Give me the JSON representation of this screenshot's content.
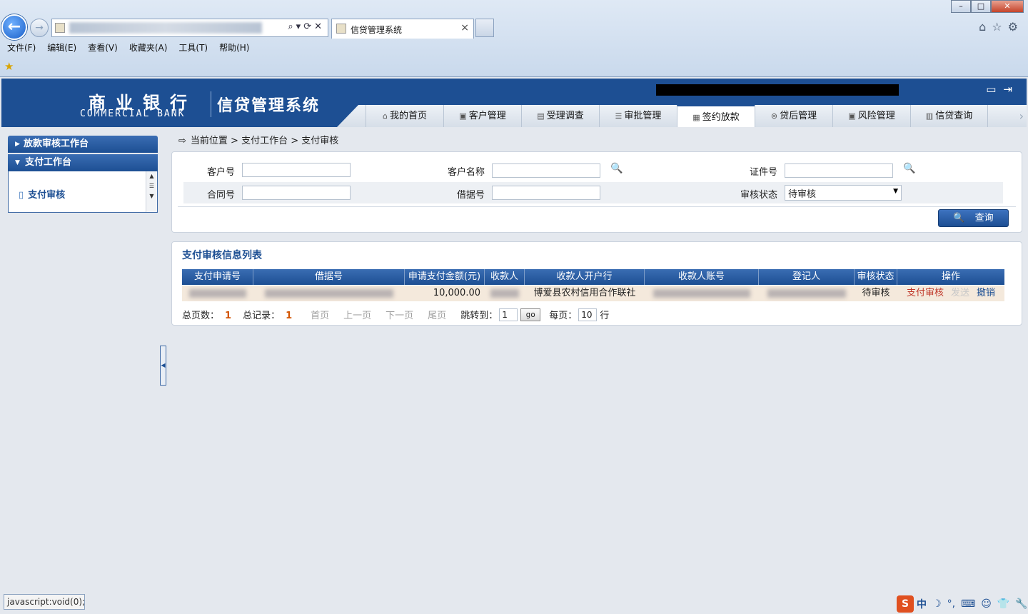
{
  "browser": {
    "tab_title": "信贷管理系统",
    "menu": [
      "文件(F)",
      "编辑(E)",
      "查看(V)",
      "收藏夹(A)",
      "工具(T)",
      "帮助(H)"
    ],
    "status_text": "javascript:void(0);"
  },
  "header": {
    "bank_cn": "商业银行",
    "bank_en": "COMMERCIAL BANK",
    "system_name": "信贷管理系统",
    "nav": [
      "我的首页",
      "客户管理",
      "受理调查",
      "审批管理",
      "签约放款",
      "贷后管理",
      "风险管理",
      "信贷查询"
    ],
    "active_nav": "签约放款"
  },
  "sidebar": {
    "group1": "放款审核工作台",
    "group2": "支付工作台",
    "item": "支付审核"
  },
  "breadcrumb": "当前位置 > 支付工作台 > 支付审核",
  "search": {
    "customer_no_label": "客户号",
    "customer_name_label": "客户名称",
    "id_no_label": "证件号",
    "contract_no_label": "合同号",
    "loan_no_label": "借据号",
    "status_label": "审核状态",
    "status_value": "待审核",
    "query_button": "查询"
  },
  "list": {
    "title": "支付审核信息列表",
    "columns": [
      "支付申请号",
      "借据号",
      "申请支付金额(元)",
      "收款人",
      "收款人开户行",
      "收款人账号",
      "登记人",
      "审核状态",
      "操作"
    ],
    "rows": [
      {
        "amount": "10,000.00",
        "bank": "博爱县农村信用合作联社",
        "status": "待审核",
        "action_review": "支付审核",
        "action_send": "发送",
        "action_cancel": "撤销"
      }
    ]
  },
  "pager": {
    "total_pages_label": "总页数：",
    "total_pages": "1",
    "total_records_label": "总记录：",
    "total_records": "1",
    "first": "首页",
    "prev": "上一页",
    "next": "下一页",
    "last": "尾页",
    "jump_label": "跳转到：",
    "jump_value": "1",
    "go": "go",
    "per_page_label": "每页：",
    "per_page": "10",
    "per_page_unit": "行"
  },
  "ime": {
    "lang": "中"
  }
}
